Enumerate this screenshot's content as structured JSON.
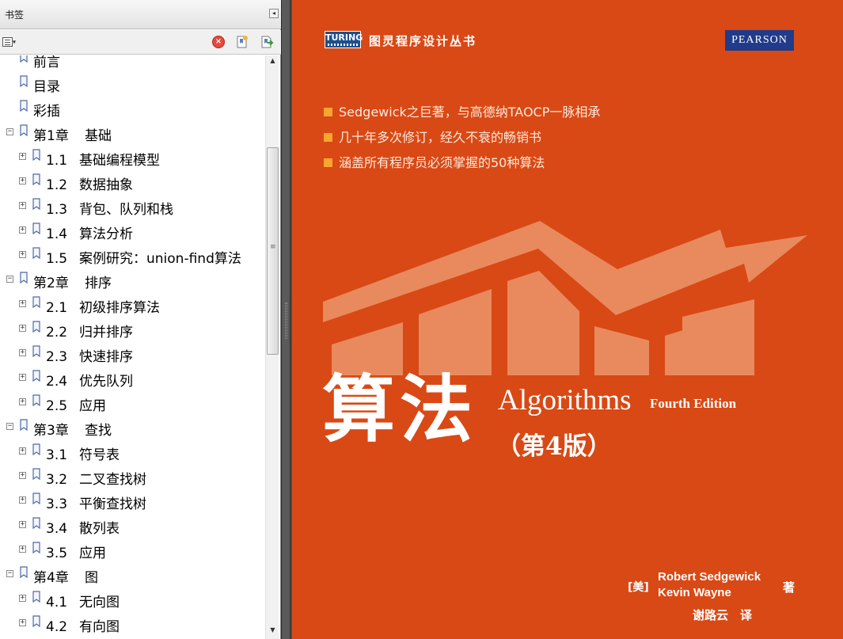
{
  "bookmarks_panel": {
    "title": "书签",
    "collapse_icon": "triangle-left-icon",
    "toolbar": {
      "options_icon": "list-options-icon",
      "delete_icon": "delete-bookmark-icon",
      "new_icon": "new-bookmark-icon",
      "expand_icon": "expand-bookmark-icon"
    },
    "items": [
      {
        "level": 0,
        "toggle": "",
        "label": "前言"
      },
      {
        "level": 0,
        "toggle": "",
        "label": "目录"
      },
      {
        "level": 0,
        "toggle": "",
        "label": "彩插"
      },
      {
        "level": 0,
        "toggle": "−",
        "chapter": "第1章",
        "label": "基础"
      },
      {
        "level": 1,
        "toggle": "+",
        "num": "1.1",
        "label": "基础编程模型"
      },
      {
        "level": 1,
        "toggle": "+",
        "num": "1.2",
        "label": "数据抽象"
      },
      {
        "level": 1,
        "toggle": "+",
        "num": "1.3",
        "label": "背包、队列和栈"
      },
      {
        "level": 1,
        "toggle": "+",
        "num": "1.4",
        "label": "算法分析"
      },
      {
        "level": 1,
        "toggle": "+",
        "num": "1.5",
        "label": "案例研究：union-find算法"
      },
      {
        "level": 0,
        "toggle": "−",
        "chapter": "第2章",
        "label": "排序"
      },
      {
        "level": 1,
        "toggle": "+",
        "num": "2.1",
        "label": "初级排序算法"
      },
      {
        "level": 1,
        "toggle": "+",
        "num": "2.2",
        "label": "归并排序"
      },
      {
        "level": 1,
        "toggle": "+",
        "num": "2.3",
        "label": "快速排序"
      },
      {
        "level": 1,
        "toggle": "+",
        "num": "2.4",
        "label": "优先队列"
      },
      {
        "level": 1,
        "toggle": "+",
        "num": "2.5",
        "label": "应用"
      },
      {
        "level": 0,
        "toggle": "−",
        "chapter": "第3章",
        "label": "查找"
      },
      {
        "level": 1,
        "toggle": "+",
        "num": "3.1",
        "label": "符号表"
      },
      {
        "level": 1,
        "toggle": "+",
        "num": "3.2",
        "label": "二叉查找树"
      },
      {
        "level": 1,
        "toggle": "+",
        "num": "3.3",
        "label": "平衡查找树"
      },
      {
        "level": 1,
        "toggle": "+",
        "num": "3.4",
        "label": "散列表"
      },
      {
        "level": 1,
        "toggle": "+",
        "num": "3.5",
        "label": "应用"
      },
      {
        "level": 0,
        "toggle": "−",
        "chapter": "第4章",
        "label": "图"
      },
      {
        "level": 1,
        "toggle": "+",
        "num": "4.1",
        "label": "无向图"
      },
      {
        "level": 1,
        "toggle": "+",
        "num": "4.2",
        "label": "有向图"
      }
    ]
  },
  "cover": {
    "publisher_logo": "TURING",
    "series_title": "图灵程序设计丛书",
    "pearson_logo": "PEARSON",
    "bullets": [
      "Sedgewick之巨著，与高德纳TAOCP一脉相承",
      "几十年多次修订，经久不衰的畅销书",
      "涵盖所有程序员必须掌握的50种算法"
    ],
    "title_cn": "算法",
    "title_en": "Algorithms",
    "edition_en": "Fourth Edition",
    "edition_cn": "（第4版）",
    "author_country": "[美]",
    "author_1": "Robert Sedgewick",
    "author_2": "Kevin Wayne",
    "author_role": "著",
    "translator": "谢路云　译",
    "colors": {
      "background": "#d94915",
      "graphic": "#e88a5e",
      "bullet_square": "#f9a531",
      "pearson": "#1f3b8a",
      "turing": "#1e4f8c"
    }
  }
}
